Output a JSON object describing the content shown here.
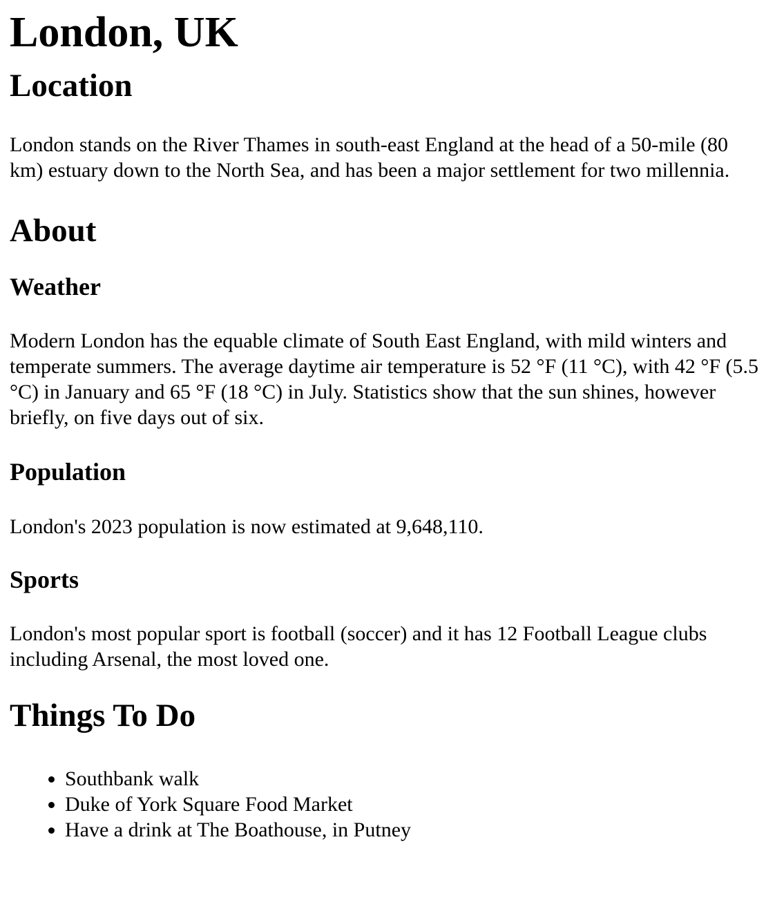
{
  "page": {
    "title": "London, UK"
  },
  "sections": {
    "location": {
      "heading": "Location",
      "text": "London stands on the River Thames in south-east England at the head of a 50-mile (80 km) estuary down to the North Sea, and has been a major settlement for two millennia."
    },
    "about": {
      "heading": "About",
      "weather": {
        "heading": "Weather",
        "text": "Modern London has the equable climate of South East England, with mild winters and temperate summers. The average daytime air temperature is 52 °F (11 °C), with 42 °F (5.5 °C) in January and 65 °F (18 °C) in July. Statistics show that the sun shines, however briefly, on five days out of six."
      },
      "population": {
        "heading": "Population",
        "text": "London's 2023 population is now estimated at 9,648,110."
      },
      "sports": {
        "heading": "Sports",
        "text": "London's most popular sport is football (soccer) and it has 12 Football League clubs including Arsenal, the most loved one."
      }
    },
    "things_to_do": {
      "heading": "Things To Do",
      "items": [
        "Southbank walk",
        "Duke of York Square Food Market",
        "Have a drink at The Boathouse, in Putney"
      ]
    }
  }
}
